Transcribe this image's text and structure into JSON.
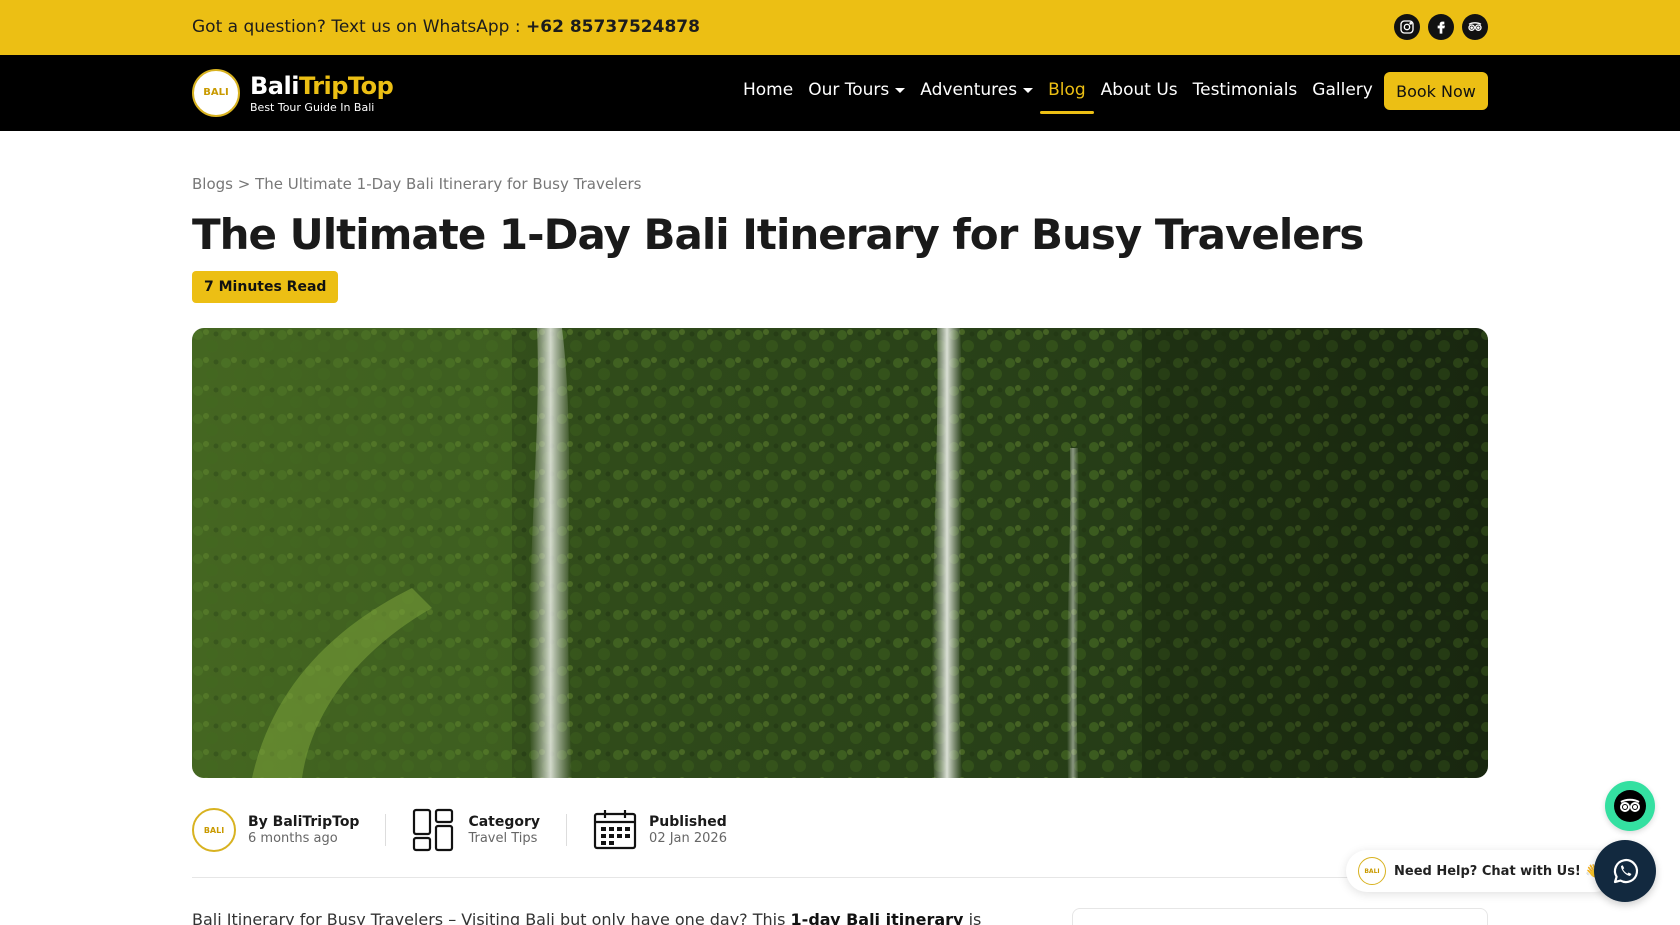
{
  "topbar": {
    "prefix": "Got a question? Text us on WhatsApp :",
    "phone": "+62 85737524878",
    "socials": [
      "instagram-icon",
      "facebook-icon",
      "tripadvisor-icon"
    ]
  },
  "brand": {
    "badge": "BALI",
    "name_part1": "Bali",
    "name_part2": "TripTop",
    "tagline": "Best Tour Guide In Bali",
    "accent": "#ecbf14"
  },
  "nav": {
    "items": [
      {
        "label": "Home"
      },
      {
        "label": "Our Tours"
      },
      {
        "label": "Adventures"
      },
      {
        "label": "Blog"
      },
      {
        "label": "About Us"
      },
      {
        "label": "Testimonials"
      },
      {
        "label": "Gallery"
      }
    ],
    "cta": "Book Now"
  },
  "breadcrumb": {
    "root": "Blogs",
    "separator": ">",
    "current": "The Ultimate 1-Day Bali Itinerary for Busy Travelers"
  },
  "article": {
    "title": "The Ultimate 1-Day Bali Itinerary for Busy Travelers",
    "read_time": "7 Minutes Read",
    "author_label": "By BaliTripTop",
    "author_time": "6 months ago",
    "category_label": "Category",
    "category_value": "Travel Tips",
    "published_label": "Published",
    "published_value": "02 Jan 2026",
    "intro_a": "Bali Itinerary for Busy Travelers – Visiting Bali but only have one day? This ",
    "intro_bold": "1-day Bali itinerary",
    "intro_b": " is"
  },
  "widgets": {
    "chat_text": "Need Help? Chat with Us! 👋"
  }
}
